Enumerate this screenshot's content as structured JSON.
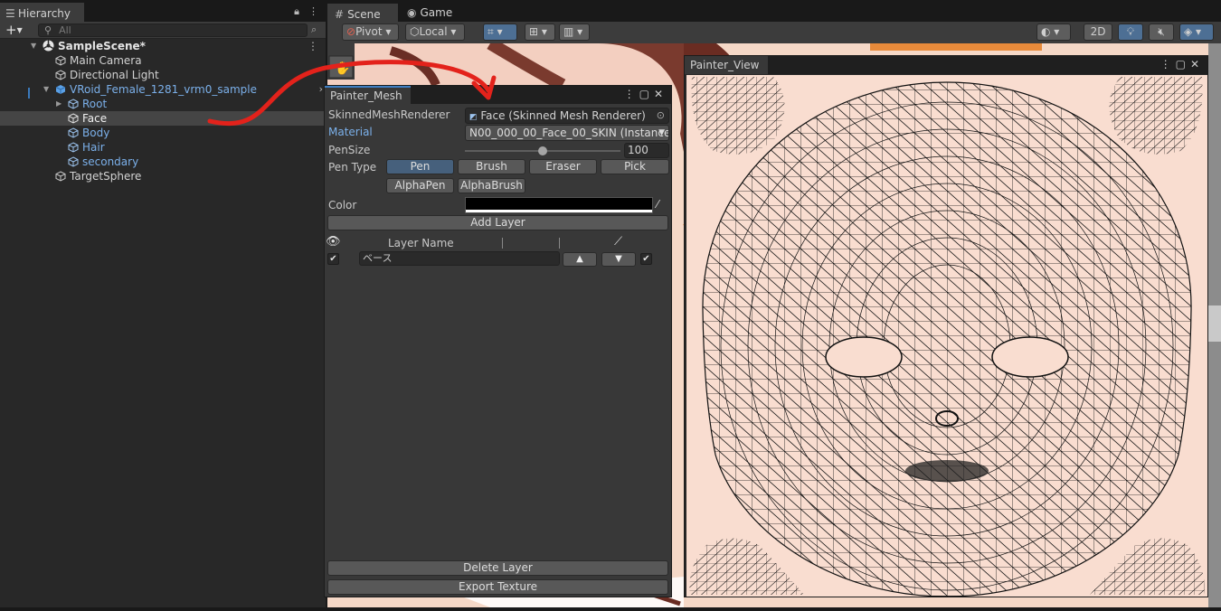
{
  "hierarchy": {
    "tab_label": "Hierarchy",
    "search_placeholder": "All",
    "scene_name": "SampleScene*",
    "items": [
      {
        "label": "Main Camera"
      },
      {
        "label": "Directional Light"
      },
      {
        "label": "VRoid_Female_1281_vrm0_sample"
      },
      {
        "label": "Root"
      },
      {
        "label": "Face"
      },
      {
        "label": "Body"
      },
      {
        "label": "Hair"
      },
      {
        "label": "secondary"
      },
      {
        "label": "TargetSphere"
      }
    ]
  },
  "scene": {
    "tabs": [
      "Scene",
      "Game"
    ],
    "pivot_label": "Pivot",
    "local_label": "Local",
    "mode_2d_label": "2D"
  },
  "painter_mesh": {
    "title": "Painter_Mesh",
    "skinned_label": "SkinnedMeshRenderer",
    "skinned_value": "Face (Skinned Mesh Renderer)",
    "material_label": "Material",
    "material_value": "N00_000_00_Face_00_SKIN (Instance)",
    "pensize_label": "PenSize",
    "pensize_value": "100",
    "pensize_fraction": 0.5,
    "pentype_label": "Pen Type",
    "pen_types": [
      "Pen",
      "Brush",
      "Eraser",
      "Pick",
      "AlphaPen",
      "AlphaBrush"
    ],
    "selected_pen_type": "Pen",
    "color_label": "Color",
    "color_value": "#000000",
    "add_layer_label": "Add Layer",
    "layer_name_header": "Layer Name",
    "layers": [
      {
        "name": "ベース",
        "visible": true,
        "paint": true
      }
    ],
    "delete_layer_label": "Delete Layer",
    "export_texture_label": "Export Texture"
  },
  "painter_view": {
    "title": "Painter_View"
  },
  "colors": {
    "accent": "#3e7ec2",
    "link": "#7bb0ea",
    "annotation": "#e3221b",
    "skin": "#f9ddd0"
  }
}
